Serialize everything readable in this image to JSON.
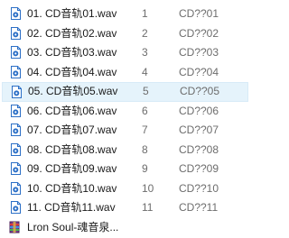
{
  "files": [
    {
      "name": "01. CD音轨01.wav",
      "track": "1",
      "title": "CD??01",
      "icon": "wav-audio-file-icon",
      "selected": false
    },
    {
      "name": "02. CD音轨02.wav",
      "track": "2",
      "title": "CD??02",
      "icon": "wav-audio-file-icon",
      "selected": false
    },
    {
      "name": "03. CD音轨03.wav",
      "track": "3",
      "title": "CD??03",
      "icon": "wav-audio-file-icon",
      "selected": false
    },
    {
      "name": "04. CD音轨04.wav",
      "track": "4",
      "title": "CD??04",
      "icon": "wav-audio-file-icon",
      "selected": false
    },
    {
      "name": "05. CD音轨05.wav",
      "track": "5",
      "title": "CD??05",
      "icon": "wav-audio-file-icon",
      "selected": true
    },
    {
      "name": "06. CD音轨06.wav",
      "track": "6",
      "title": "CD??06",
      "icon": "wav-audio-file-icon",
      "selected": false
    },
    {
      "name": "07. CD音轨07.wav",
      "track": "7",
      "title": "CD??07",
      "icon": "wav-audio-file-icon",
      "selected": false
    },
    {
      "name": "08. CD音轨08.wav",
      "track": "8",
      "title": "CD??08",
      "icon": "wav-audio-file-icon",
      "selected": false
    },
    {
      "name": "09. CD音轨09.wav",
      "track": "9",
      "title": "CD??09",
      "icon": "wav-audio-file-icon",
      "selected": false
    },
    {
      "name": "10. CD音轨10.wav",
      "track": "10",
      "title": "CD??10",
      "icon": "wav-audio-file-icon",
      "selected": false
    },
    {
      "name": "11. CD音轨11.wav",
      "track": "11",
      "title": "CD??11",
      "icon": "wav-audio-file-icon",
      "selected": false
    }
  ],
  "archive": {
    "name": "Lron Soul-魂音泉...",
    "icon": "rar-archive-icon"
  },
  "colors": {
    "selection_bg": "#e5f3fb",
    "selection_border": "#d8ebf7",
    "secondary_text": "#6d6d6d",
    "icon_blue": "#2b6fc6"
  }
}
